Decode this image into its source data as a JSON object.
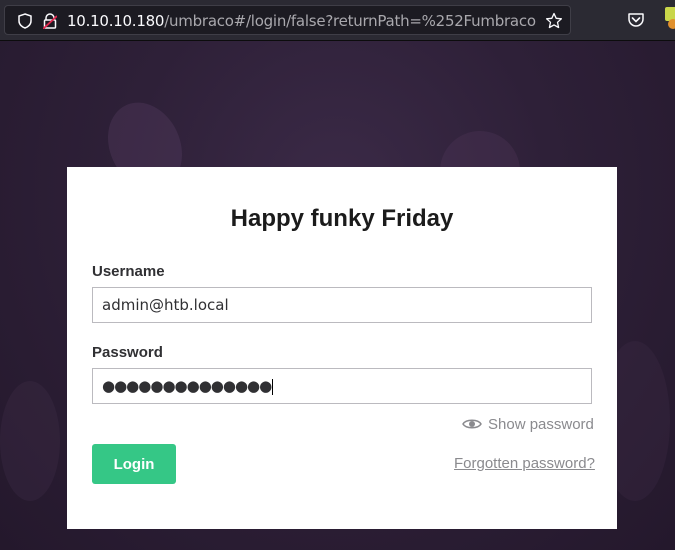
{
  "browser": {
    "url_host": "10.10.10.180",
    "url_path": "/umbraco#/login/false?returnPath=%252Fumbraco",
    "icons": [
      "shield-icon",
      "lock-warning-icon",
      "star-icon",
      "pocket-icon",
      "extension-icon"
    ]
  },
  "login": {
    "title": "Happy funky Friday",
    "username_label": "Username",
    "username_value": "admin@htb.local",
    "password_label": "Password",
    "password_value": "●●●●●●●●●●●●●●",
    "show_password": "Show password",
    "login_button": "Login",
    "forgot_link": "Forgotten password?"
  },
  "colors": {
    "accent": "#35c786",
    "background": "#2b1d33"
  }
}
